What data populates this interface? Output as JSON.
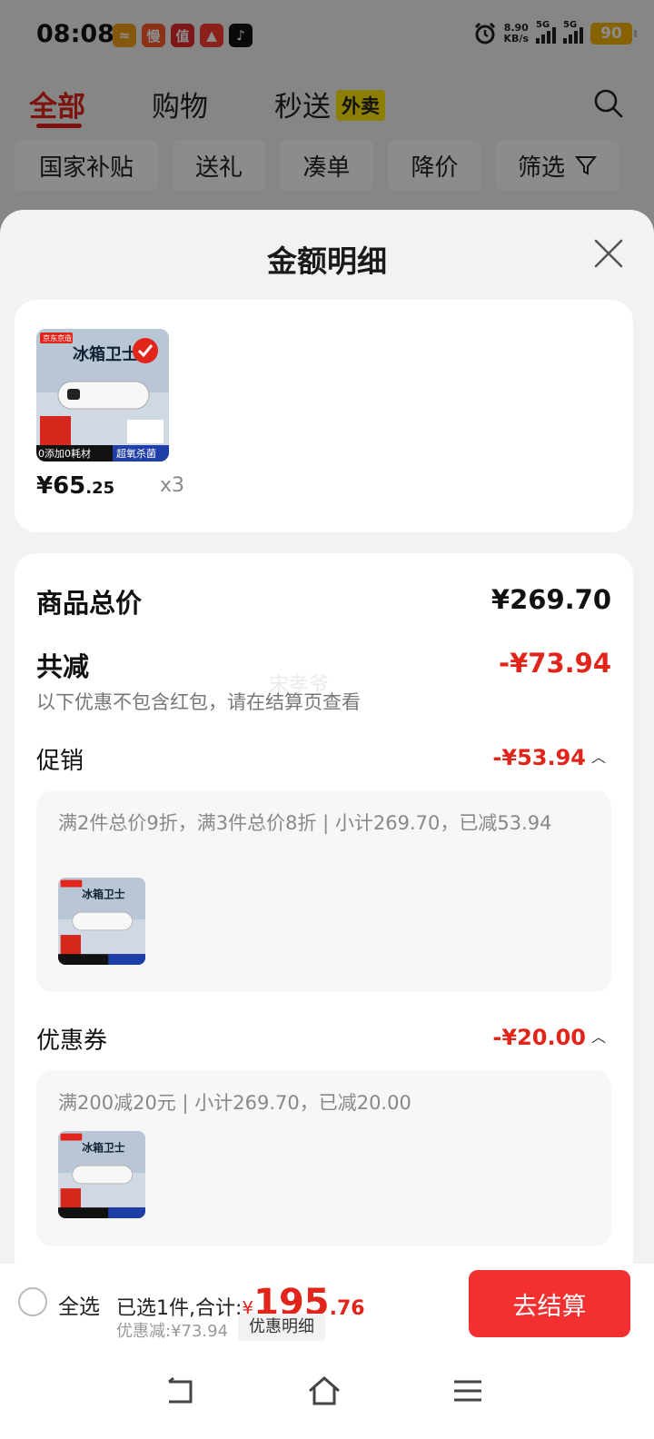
{
  "status_bar": {
    "time": "08:08",
    "app_icons": [
      {
        "name": "app-icon-1",
        "glyph": "≈",
        "color": "#f5a01b"
      },
      {
        "name": "app-icon-2",
        "glyph": "慢",
        "color": "#ff5a2b"
      },
      {
        "name": "app-icon-3",
        "glyph": "值",
        "color": "#e62b2b"
      },
      {
        "name": "app-icon-4",
        "glyph": "▲",
        "color": "#ff3b30"
      },
      {
        "name": "app-icon-5",
        "glyph": "♪",
        "color": "#111111"
      }
    ],
    "net_speed_value": "8.90",
    "net_speed_unit": "KB/s",
    "signal_1": "5G",
    "signal_2": "5G",
    "battery": "90"
  },
  "top_tabs": {
    "all": "全部",
    "shopping": "购物",
    "express": "秒送",
    "express_badge": "外卖"
  },
  "filters": [
    "国家补贴",
    "送礼",
    "凑单",
    "降价",
    "筛选"
  ],
  "sheet": {
    "title": "金额明细",
    "watermark": "宋孝爷",
    "product": {
      "price_int": "¥65",
      "price_dec": ".25",
      "qty": "x3",
      "thumb_brand": "京东京造",
      "thumb_title": "冰箱卫士",
      "thumb_footer_left": "0添加0耗材",
      "thumb_footer_right": "超氧杀菌"
    },
    "total_label": "商品总价",
    "total_value": "¥269.70",
    "discount_label": "共减",
    "discount_value": "-¥73.94",
    "discount_note": "以下优惠不包含红包，请在结算页查看",
    "promo": {
      "label": "促销",
      "value": "-¥53.94",
      "desc": "满2件总价9折，满3件总价8折 | 小计269.70，已减53.94"
    },
    "coupon": {
      "label": "优惠券",
      "value": "-¥20.00",
      "desc": "满200减20元 | 小计269.70，已减20.00"
    }
  },
  "checkout": {
    "select_all": "全选",
    "selected_prefix": "已选1件,合计:",
    "total_yen": "¥",
    "total_int": "195",
    "total_dec": ".76",
    "discount_text": "优惠减:¥73.94",
    "detail_button": "优惠明细",
    "checkout_button": "去结算"
  },
  "colors": {
    "accent_red": "#e1251b",
    "checkout_button": "#f2302f"
  }
}
